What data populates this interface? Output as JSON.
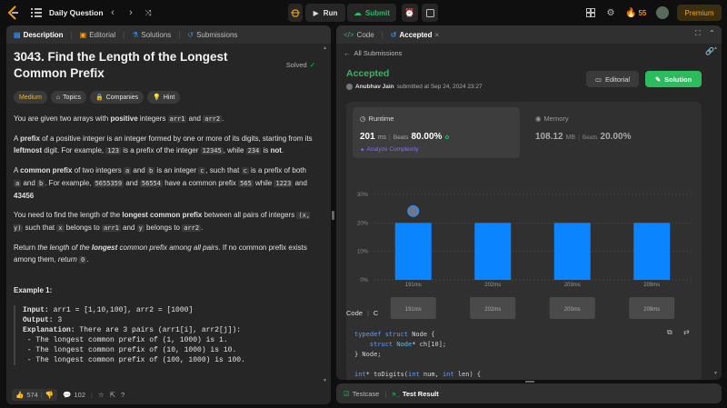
{
  "topbar": {
    "title": "Daily Question",
    "run": "Run",
    "submit": "Submit",
    "streak": "55",
    "premium": "Premium"
  },
  "left_tabs": [
    "Description",
    "Editorial",
    "Solutions",
    "Submissions"
  ],
  "problem": {
    "title": "3043. Find the Length of the Longest Common Prefix",
    "status": "Solved",
    "difficulty": "Medium",
    "tags": [
      "Topics",
      "Companies",
      "Hint"
    ],
    "p1": [
      "You are given two arrays with ",
      "positive",
      " integers ",
      "arr1",
      " and ",
      "arr2",
      "."
    ],
    "p2": [
      "A ",
      "prefix",
      " of a positive integer is an integer formed by one or more of its digits, starting from its ",
      "leftmost",
      " digit. For example, ",
      "123",
      " is a prefix of the integer ",
      "12345",
      ", while ",
      "234",
      " is ",
      "not",
      "."
    ],
    "p3": [
      "A ",
      "common prefix",
      " of two integers ",
      "a",
      " and ",
      "b",
      " is an integer ",
      "c",
      ", such that ",
      "c",
      " is a prefix of both ",
      "a",
      " and ",
      "b",
      ". For example, ",
      "5655359",
      " and ",
      "56554",
      " have a common prefix ",
      "565",
      " while ",
      "1223",
      " and ",
      "43456",
      " ",
      "do not",
      " have a common prefix."
    ],
    "p4": [
      "You need to find the length of the ",
      "longest common prefix",
      " between all pairs of integers ",
      "(x, y)",
      " such that ",
      "x",
      " belongs to ",
      "arr1",
      " and ",
      "y",
      " belongs to ",
      "arr2",
      "."
    ],
    "p5": [
      "Return ",
      "the length of the ",
      "longest",
      " common prefix among all pairs",
      ". If no common prefix exists among them",
      ", return ",
      "0",
      "."
    ],
    "example_title": "Example 1:",
    "example_lines": [
      [
        "Input:",
        " arr1 = [1,10,100], arr2 = [1000]"
      ],
      [
        "Output:",
        " 3"
      ],
      [
        "Explanation:",
        " There are 3 pairs (arr1[i], arr2[j]):"
      ],
      [
        "",
        " - The longest common prefix of (1, 1000) is 1."
      ],
      [
        "",
        " - The longest common prefix of (10, 1000) is 10."
      ],
      [
        "",
        " - The longest common prefix of (100, 1000) is 100."
      ]
    ]
  },
  "footer": {
    "likes": "574",
    "comments": "102"
  },
  "right_tabs": {
    "code": "Code",
    "accepted": "Accepted"
  },
  "all_submissions": "All Submissions",
  "result": {
    "status": "Accepted",
    "user": "Anubhav Jain",
    "submitted": " submitted at Sep 24, 2024 23:27",
    "editorial": "Editorial",
    "solution": "Solution",
    "runtime_label": "Runtime",
    "runtime_value": "201",
    "runtime_unit": "ms",
    "beats": "Beats",
    "runtime_beats": "80.00%",
    "analyze": "Analyze Complexity",
    "memory_label": "Memory",
    "memory_value": "108.12",
    "memory_unit": "MB",
    "memory_beats": "20.00%"
  },
  "chart_data": {
    "type": "bar",
    "categories": [
      "191ms",
      "202ms",
      "203ms",
      "209ms"
    ],
    "values": [
      20,
      20,
      20,
      20
    ],
    "ylim": [
      0,
      30
    ],
    "yticks": [
      "30%",
      "20%",
      "10%",
      "0%"
    ],
    "colors": {
      "bar": "#0a84ff"
    }
  },
  "code_section": {
    "label": "Code",
    "lang": "C",
    "lines": [
      [
        [
          "typedef struct ",
          "kw"
        ],
        [
          "Node",
          ""
        ],
        [
          " {",
          ""
        ]
      ],
      [
        [
          "    struct ",
          "kw"
        ],
        [
          "Node",
          "ty"
        ],
        [
          "* ch[10];",
          ""
        ]
      ],
      [
        [
          "} Node;",
          ""
        ]
      ],
      [
        [
          "",
          ""
        ]
      ],
      [
        [
          "int",
          "kw"
        ],
        [
          "* toDigits(",
          ""
        ],
        [
          "int",
          "kw"
        ],
        [
          " num, ",
          ""
        ],
        [
          "int",
          "kw"
        ],
        [
          " len) {",
          ""
        ]
      ]
    ]
  },
  "bottom_tabs": {
    "testcase": "Testcase",
    "result": "Test Result"
  }
}
